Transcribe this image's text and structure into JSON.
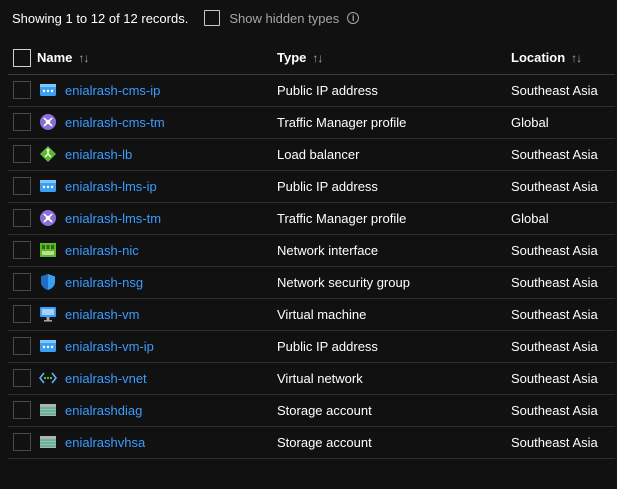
{
  "summary": "Showing 1 to 12 of 12 records.",
  "show_hidden_label": "Show hidden types",
  "info_glyph": "i",
  "columns": {
    "name": "Name",
    "type": "Type",
    "location": "Location",
    "sort_glyph": "↑↓"
  },
  "rows": [
    {
      "name": "enialrash-cms-ip",
      "type": "Public IP address",
      "location": "Southeast Asia",
      "icon": "public-ip"
    },
    {
      "name": "enialrash-cms-tm",
      "type": "Traffic Manager profile",
      "location": "Global",
      "icon": "traffic-manager"
    },
    {
      "name": "enialrash-lb",
      "type": "Load balancer",
      "location": "Southeast Asia",
      "icon": "load-balancer"
    },
    {
      "name": "enialrash-lms-ip",
      "type": "Public IP address",
      "location": "Southeast Asia",
      "icon": "public-ip"
    },
    {
      "name": "enialrash-lms-tm",
      "type": "Traffic Manager profile",
      "location": "Global",
      "icon": "traffic-manager"
    },
    {
      "name": "enialrash-nic",
      "type": "Network interface",
      "location": "Southeast Asia",
      "icon": "network-interface"
    },
    {
      "name": "enialrash-nsg",
      "type": "Network security group",
      "location": "Southeast Asia",
      "icon": "security-group"
    },
    {
      "name": "enialrash-vm",
      "type": "Virtual machine",
      "location": "Southeast Asia",
      "icon": "virtual-machine"
    },
    {
      "name": "enialrash-vm-ip",
      "type": "Public IP address",
      "location": "Southeast Asia",
      "icon": "public-ip"
    },
    {
      "name": "enialrash-vnet",
      "type": "Virtual network",
      "location": "Southeast Asia",
      "icon": "virtual-network"
    },
    {
      "name": "enialrashdiag",
      "type": "Storage account",
      "location": "Southeast Asia",
      "icon": "storage-account"
    },
    {
      "name": "enialrashvhsa",
      "type": "Storage account",
      "location": "Southeast Asia",
      "icon": "storage-account"
    }
  ],
  "colors": {
    "link": "#3b9cff",
    "background": "#111111"
  }
}
